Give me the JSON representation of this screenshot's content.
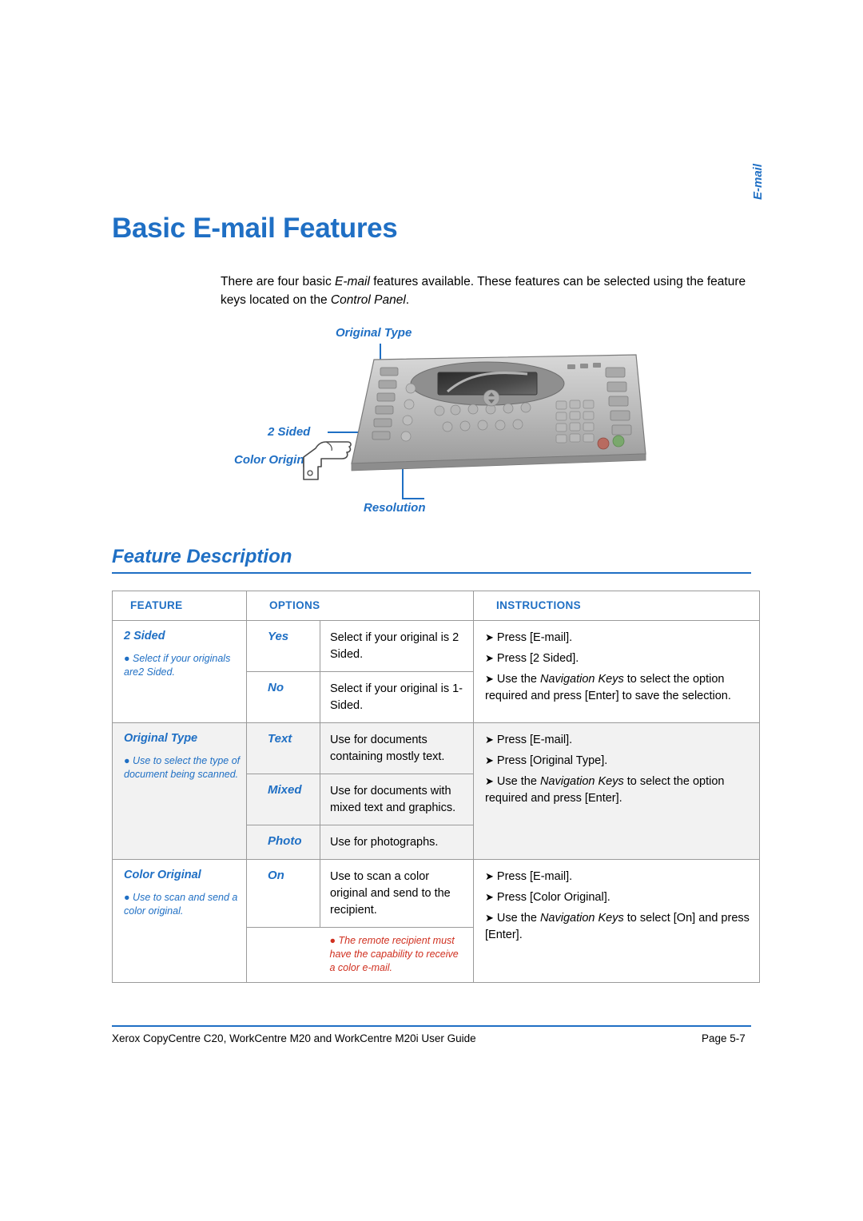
{
  "page": {
    "title": "Basic E-mail Features",
    "side_tab": "E-mail",
    "intro_html": "There are four basic <i>E-mail</i> features available. These features can be selected using the feature keys located on the <i>Control Panel</i>.",
    "section_title": "Feature Description"
  },
  "figure": {
    "labels": {
      "original_type": "Original Type",
      "two_sided": "2 Sided",
      "color_original": "Color Original",
      "resolution": "Resolution"
    }
  },
  "table": {
    "headers": {
      "feature": "FEATURE",
      "options": "OPTIONS",
      "instructions": "INSTRUCTIONS"
    },
    "rows": [
      {
        "feature": "2 Sided",
        "feature_note": "Select if your originals are2 Sided.",
        "options": [
          {
            "label": "Yes",
            "desc": "Select if your original is 2 Sided."
          },
          {
            "label": "No",
            "desc": "Select if your original is 1-Sided."
          }
        ],
        "instructions_html": "<div class=\"line\"><span class=\"ar\">&#10148;</span> Press [E-mail].</div><div class=\"line\"><span class=\"ar\">&#10148;</span> Press [2 Sided].</div><div class=\"line\"><span class=\"ar\">&#10148;</span> Use the <i>Navigation Keys</i> to select the option required and press [Enter] to save the selection.</div>"
      },
      {
        "feature": "Original Type",
        "feature_note": "Use to select the type of document being scanned.",
        "options": [
          {
            "label": "Text",
            "desc": "Use for documents containing mostly text."
          },
          {
            "label": "Mixed",
            "desc": "Use for documents with mixed text and graphics."
          },
          {
            "label": "Photo",
            "desc": "Use for photographs."
          }
        ],
        "instructions_html": "<div class=\"line\"><span class=\"ar\">&#10148;</span> Press [E-mail].</div><div class=\"line\"><span class=\"ar\">&#10148;</span> Press [Original Type].</div><div class=\"line\"><span class=\"ar\">&#10148;</span> Use the <i>Navigation Keys</i> to select the option required and press [Enter].</div>"
      },
      {
        "feature": "Color Original",
        "feature_note": "Use to scan and send a color original.",
        "options": [
          {
            "label": "On",
            "desc": "Use to scan a color original and send to the recipient."
          }
        ],
        "option_warning": "The remote recipient must have the capability to receive a color e-mail.",
        "instructions_html": "<div class=\"line\"><span class=\"ar\">&#10148;</span> Press [E-mail].</div><div class=\"line\"><span class=\"ar\">&#10148;</span> Press [Color Original].</div><div class=\"line\"><span class=\"ar\">&#10148;</span> Use the <i>Navigation Keys</i> to select [On] and press [Enter].</div>"
      }
    ]
  },
  "footer": {
    "left": "Xerox CopyCentre C20, WorkCentre M20 and WorkCentre M20i User Guide",
    "right": "Page  5-7"
  }
}
